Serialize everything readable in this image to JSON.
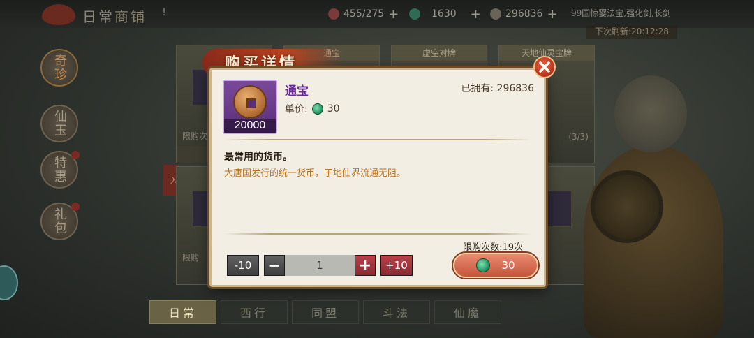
{
  "header": {
    "shop_title": "日常商铺",
    "help": "!",
    "stamina": "455/275",
    "jade": "1630",
    "coins": "296836",
    "notice": "99国惊婴法宝,强化剑,长剑",
    "refresh": "下次刷新:20:12:28"
  },
  "categories": [
    {
      "label": "奇珍"
    },
    {
      "label": "仙玉"
    },
    {
      "label": "特惠"
    },
    {
      "label": "礼包"
    }
  ],
  "side_tag": "入",
  "bg_cards": [
    {
      "name": "通宝"
    },
    {
      "name": "虚空对牌"
    },
    {
      "name": "天地仙灵宝牌"
    },
    {
      "name": "限购"
    }
  ],
  "bg_limit": "限购次",
  "bg_limit_right": "(3/3)",
  "bottom_tabs": [
    {
      "label": "日常"
    },
    {
      "label": "西行"
    },
    {
      "label": "同盟"
    },
    {
      "label": "斗法"
    },
    {
      "label": "仙魔"
    }
  ],
  "modal": {
    "title": "购买详情",
    "item": {
      "name": "通宝",
      "count": "20000",
      "coin_chars": "崩国宝通",
      "unit_price_label": "单价:",
      "unit_price": "30",
      "owned_label": "已拥有:",
      "owned": "296836"
    },
    "desc_title": "最常用的货币。",
    "desc_body": "大唐国发行的统一货币，于地仙界流通无阻。",
    "quantity": {
      "minus10": "-10",
      "minus": "−",
      "value": "1",
      "plus": "+",
      "plus10": "+10"
    },
    "limit_text": "限购次数:19次",
    "buy_price": "30"
  },
  "colors": {
    "accent_red": "#c4553d",
    "item_name": "#6a2a9a",
    "desc_orange": "#b8741e",
    "panel_bg": "#f2eee4"
  }
}
